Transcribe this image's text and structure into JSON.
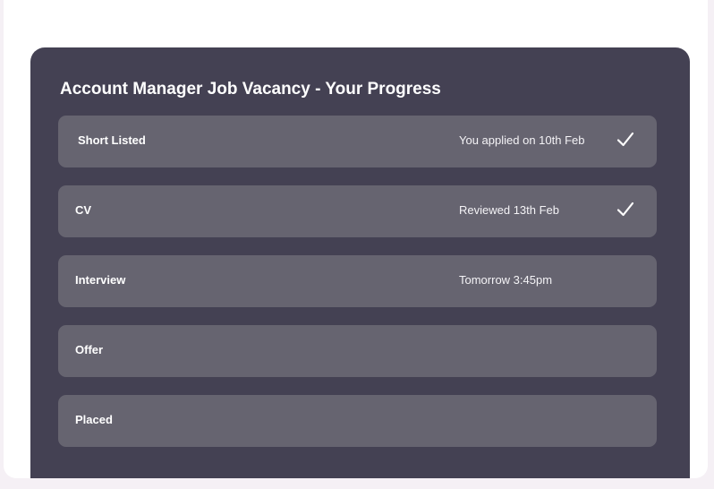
{
  "progress": {
    "title": "Account Manager Job Vacancy - Your Progress",
    "steps": [
      {
        "label": "Short Listed",
        "detail": "You applied on 10th Feb",
        "completed": true,
        "icon": "checkmark-icon"
      },
      {
        "label": "CV",
        "detail": "Reviewed 13th Feb",
        "completed": true,
        "icon": "checkmark-icon"
      },
      {
        "label": "Interview",
        "detail": "Tomorrow 3:45pm",
        "completed": false
      },
      {
        "label": "Offer",
        "detail": "",
        "completed": false
      },
      {
        "label": "Placed",
        "detail": "",
        "completed": false
      }
    ]
  },
  "colors": {
    "page_background": "#f5f0f5",
    "card_background": "#ffffff",
    "panel_background": "#444153",
    "step_background": "#666470",
    "text": "#ffffff"
  }
}
